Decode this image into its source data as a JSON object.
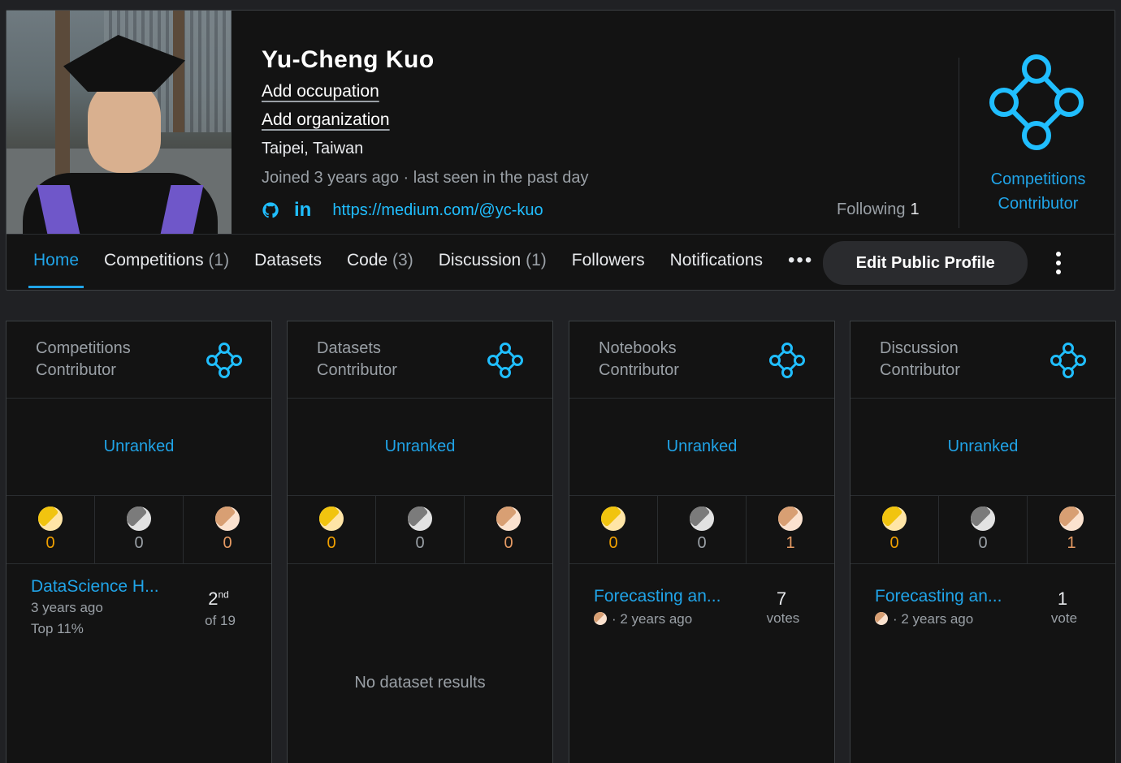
{
  "profile": {
    "name": "Yu-Cheng Kuo",
    "add_occupation": "Add occupation",
    "add_organization": "Add organization",
    "location": "Taipei, Taiwan",
    "joined": "Joined 3 years ago · last seen in the past day",
    "medium_url": "https://medium.com/@yc-kuo",
    "following_label": "Following",
    "following_count": "1",
    "tier_line1": "Competitions",
    "tier_line2": "Contributor",
    "accent_color": "#20a4e8"
  },
  "tabs": [
    {
      "label": "Home",
      "count": ""
    },
    {
      "label": "Competitions",
      "count": "(1)"
    },
    {
      "label": "Datasets",
      "count": ""
    },
    {
      "label": "Code",
      "count": "(3)"
    },
    {
      "label": "Discussion",
      "count": "(1)"
    },
    {
      "label": "Followers",
      "count": ""
    },
    {
      "label": "Notifications",
      "count": ""
    }
  ],
  "more_label": "•••",
  "edit_button": "Edit Public Profile",
  "cards": [
    {
      "title_line1": "Competitions",
      "title_line2": "Contributor",
      "rank": "Unranked",
      "gold": "0",
      "silver": "0",
      "bronze": "0",
      "item_title": "DataScience H...",
      "item_sub1": "3 years ago",
      "item_sub2": "Top 11%",
      "place": "2",
      "place_suffix": "nd",
      "of_total": "of 19"
    },
    {
      "title_line1": "Datasets",
      "title_line2": "Contributor",
      "rank": "Unranked",
      "gold": "0",
      "silver": "0",
      "bronze": "0",
      "empty_text": "No dataset results"
    },
    {
      "title_line1": "Notebooks",
      "title_line2": "Contributor",
      "rank": "Unranked",
      "gold": "0",
      "silver": "0",
      "bronze": "1",
      "item_title": "Forecasting an...",
      "item_sub": "· 2 years ago",
      "votes": "7",
      "votes_label": "votes"
    },
    {
      "title_line1": "Discussion",
      "title_line2": "Contributor",
      "rank": "Unranked",
      "gold": "0",
      "silver": "0",
      "bronze": "1",
      "item_title": "Forecasting an...",
      "item_sub": "· 2 years ago",
      "votes": "1",
      "votes_label": "vote"
    }
  ]
}
